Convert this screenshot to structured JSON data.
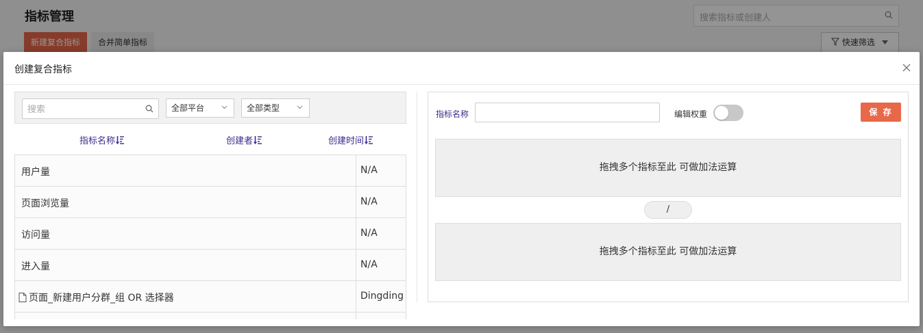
{
  "background": {
    "title": "指标管理",
    "search_placeholder": "搜索指标或创建人",
    "new_button": "新建复合指标",
    "merge_button": "合并简单指标",
    "filter_button": "快速筛选"
  },
  "modal": {
    "title": "创建复合指标",
    "left": {
      "search_placeholder": "搜索",
      "platform_select": "全部平台",
      "type_select": "全部类型",
      "columns": [
        "指标名称",
        "创建者",
        "创建时间"
      ],
      "rows": [
        {
          "name": "用户量",
          "creator": "N/A",
          "is_file": false
        },
        {
          "name": "页面浏览量",
          "creator": "N/A",
          "is_file": false
        },
        {
          "name": "访问量",
          "creator": "N/A",
          "is_file": false
        },
        {
          "name": "进入量",
          "creator": "N/A",
          "is_file": false
        },
        {
          "name": "页面_新建用户分群_组 OR 选择器",
          "creator": "Dingding",
          "is_file": true
        }
      ]
    },
    "right": {
      "name_label": "指标名称",
      "name_value": "",
      "weight_label": "编辑权重",
      "weight_enabled": false,
      "save_button": "保 存",
      "drop_zone_1": "拖拽多个指标至此 可做加法运算",
      "operator": "/",
      "drop_zone_2": "拖拽多个指标至此 可做加法运算"
    }
  },
  "colors": {
    "accent": "#e8684a",
    "column_header": "#3a2a8c"
  }
}
